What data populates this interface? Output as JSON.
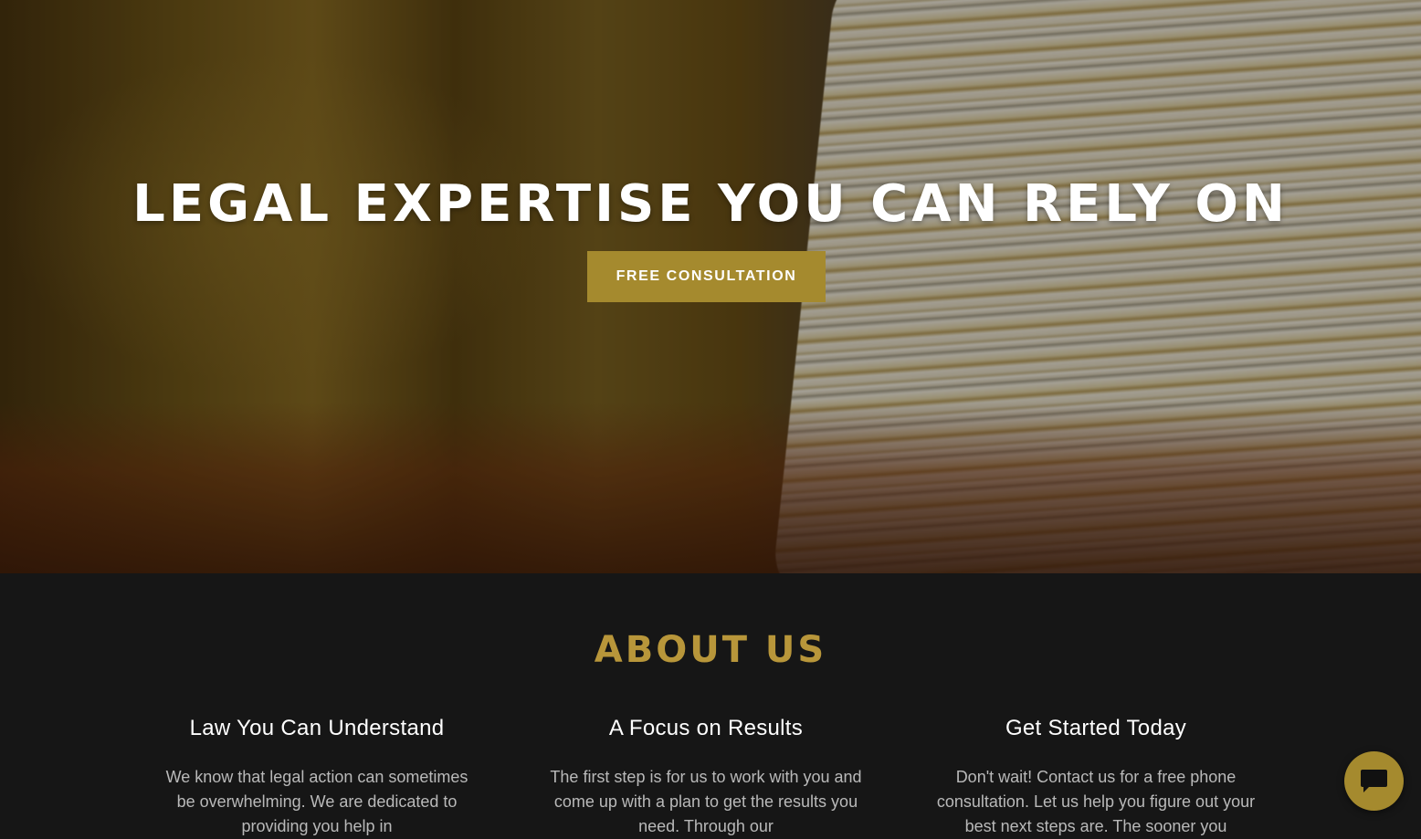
{
  "hero": {
    "title": "LEGAL EXPERTISE YOU CAN RELY ON",
    "cta_label": "FREE CONSULTATION",
    "background_image": "stack-of-paper-files-icon"
  },
  "about": {
    "title": "ABOUT US",
    "columns": [
      {
        "heading": "Law You Can Understand",
        "text": "We know that legal action can sometimes be overwhelming. We are dedicated to providing you help in"
      },
      {
        "heading": "A Focus on Results",
        "text": "The first step is for us to work with you and come up with a plan to get the results you need. Through our"
      },
      {
        "heading": "Get Started Today",
        "text": "Don't wait! Contact us for a free phone consultation. Let us help you figure out your best next steps are. The sooner you"
      }
    ]
  },
  "chat": {
    "icon": "chat-bubble-icon"
  },
  "colors": {
    "accent": "#a58a2e",
    "accent_text": "#b8963a",
    "dark_background": "#161616",
    "body_text": "#b9b9b9"
  }
}
